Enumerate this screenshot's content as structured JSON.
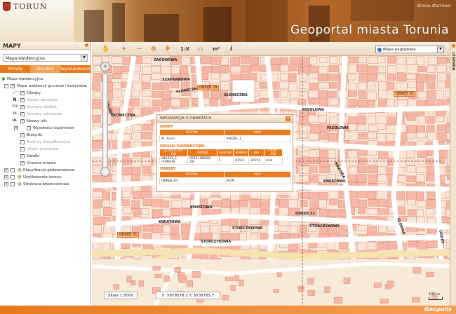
{
  "header": {
    "brand": "TORUŃ",
    "start_link": "Strona startowa",
    "title": "Geoportal miasta Torunia"
  },
  "sidebar": {
    "title": "MAPY",
    "map_select": "Mapa ewidencyjna",
    "tabs": [
      {
        "label": "Tematy",
        "active": false
      },
      {
        "label": "Warstwy",
        "active": true
      },
      {
        "label": "Wyszukiwanie",
        "active": false
      }
    ],
    "tree": [
      {
        "label": "Mapa ewidencyjna",
        "level": 0,
        "checkbox": null,
        "expander": null,
        "icon": "",
        "dim": false
      },
      {
        "label": "Mapa ewidencji gruntów i budynków",
        "level": 1,
        "checkbox": true,
        "expander": "-",
        "icon": "",
        "dim": false
      },
      {
        "label": "Obręby",
        "level": 2,
        "checkbox": true,
        "expander": null,
        "icon": "⋰",
        "dim": false
      },
      {
        "label": "Nazwy obrębów",
        "level": 2,
        "checkbox": true,
        "expander": null,
        "icon": "N",
        "dim": true
      },
      {
        "label": "Numery działek",
        "level": 2,
        "checkbox": true,
        "expander": null,
        "icon": "7/2",
        "dim": true
      },
      {
        "label": "Numery adresowe",
        "level": 2,
        "checkbox": true,
        "expander": null,
        "icon": "31",
        "dim": true
      },
      {
        "label": "Nazwy ulic",
        "level": 2,
        "checkbox": true,
        "expander": null,
        "icon": "UL",
        "dim": false
      },
      {
        "label": "Wysokości budynków",
        "level": 2,
        "checkbox": false,
        "expander": "+",
        "icon": "",
        "dim": false
      },
      {
        "label": "Budynki",
        "level": 2,
        "checkbox": true,
        "expander": null,
        "icon": "",
        "dim": false
      },
      {
        "label": "Kontury klasyfikacyjne",
        "level": 2,
        "checkbox": false,
        "expander": null,
        "icon": "",
        "dim": true
      },
      {
        "label": "Użytki gruntowe",
        "level": 2,
        "checkbox": false,
        "expander": null,
        "icon": "",
        "dim": true
      },
      {
        "label": "Działki",
        "level": 2,
        "checkbox": true,
        "expander": null,
        "icon": "",
        "dim": false
      },
      {
        "label": "Granica miasta",
        "level": 2,
        "checkbox": true,
        "expander": null,
        "icon": "",
        "dim": false
      },
      {
        "label": "Klasyfikacja gleboznawcza",
        "level": 1,
        "checkbox": false,
        "expander": "+",
        "icon": "",
        "dim": false
      },
      {
        "label": "Użytkowanie terenu",
        "level": 1,
        "checkbox": false,
        "expander": "+",
        "icon": "",
        "dim": false
      },
      {
        "label": "Struktura własnościowa",
        "level": 1,
        "checkbox": false,
        "expander": "+",
        "icon": "",
        "dim": false
      }
    ]
  },
  "toolbar": {
    "scale_tool": "1:X",
    "area_tool": "m²",
    "info_tool": "i",
    "basemap_select": "Mapa poglądowa"
  },
  "map": {
    "streets": [
      {
        "text": "ZAGONOWA"
      },
      {
        "text": "SZAFRANOWA"
      },
      {
        "text": "SŁONECZNA"
      },
      {
        "text": "SŁONECZNA"
      },
      {
        "text": "SŁONECZNA"
      },
      {
        "text": "FASOLOWA"
      },
      {
        "text": "FASOLOWA"
      },
      {
        "text": "KWIATOWA"
      },
      {
        "text": "KWIATOWA"
      },
      {
        "text": "KWIATOWA"
      },
      {
        "text": "STORCZYKOWA"
      },
      {
        "text": "STORCZYKOWA"
      },
      {
        "text": "STORCZYKOWA"
      },
      {
        "text": "SZCZĘŚLIWA"
      },
      {
        "text": "MAKOWA"
      },
      {
        "text": "GŁÓWNA"
      },
      {
        "text": "UGORY"
      },
      {
        "text": "OBRĘB 32"
      }
    ],
    "road_labels": [
      {
        "text": "OBRĘB 29"
      },
      {
        "text": "OBRĘB 30"
      },
      {
        "text": "OBRĘB 31"
      }
    ],
    "scale": "Skala 1:5000",
    "coords": "X: 5879578.2 Y: 6538785.7",
    "scalebar": "100 m"
  },
  "info": {
    "title": "INFORMACJA O OBIEKTACH",
    "gminy": {
      "section": "GMINY",
      "headers": [
        "NAZWA",
        "KOD"
      ],
      "rows": [
        [
          "M. Toruń",
          "046301_1"
        ]
      ]
    },
    "dzialki": {
      "section": "DZIAŁKI EWIDENCYJNE",
      "headers": [
        "JEDNOSTKA EW.",
        "OBRĘB",
        "ARKUSZ",
        "NUMER",
        "KW",
        "POW. EW."
      ],
      "rows": [
        [
          "046301_1 (TORUŃ)",
          "0029 (OBRĘB 29)",
          "1",
          "615/3",
          "20745",
          "618"
        ]
      ]
    },
    "obreby": {
      "section": "OBRĘBY",
      "headers": [
        "NAZWA",
        "KOD"
      ],
      "rows": [
        [
          "OBRĘB 29",
          "0029"
        ]
      ]
    }
  },
  "legend": {
    "label": "LEGENDA"
  },
  "footer": {
    "brand": "Geopolis"
  }
}
